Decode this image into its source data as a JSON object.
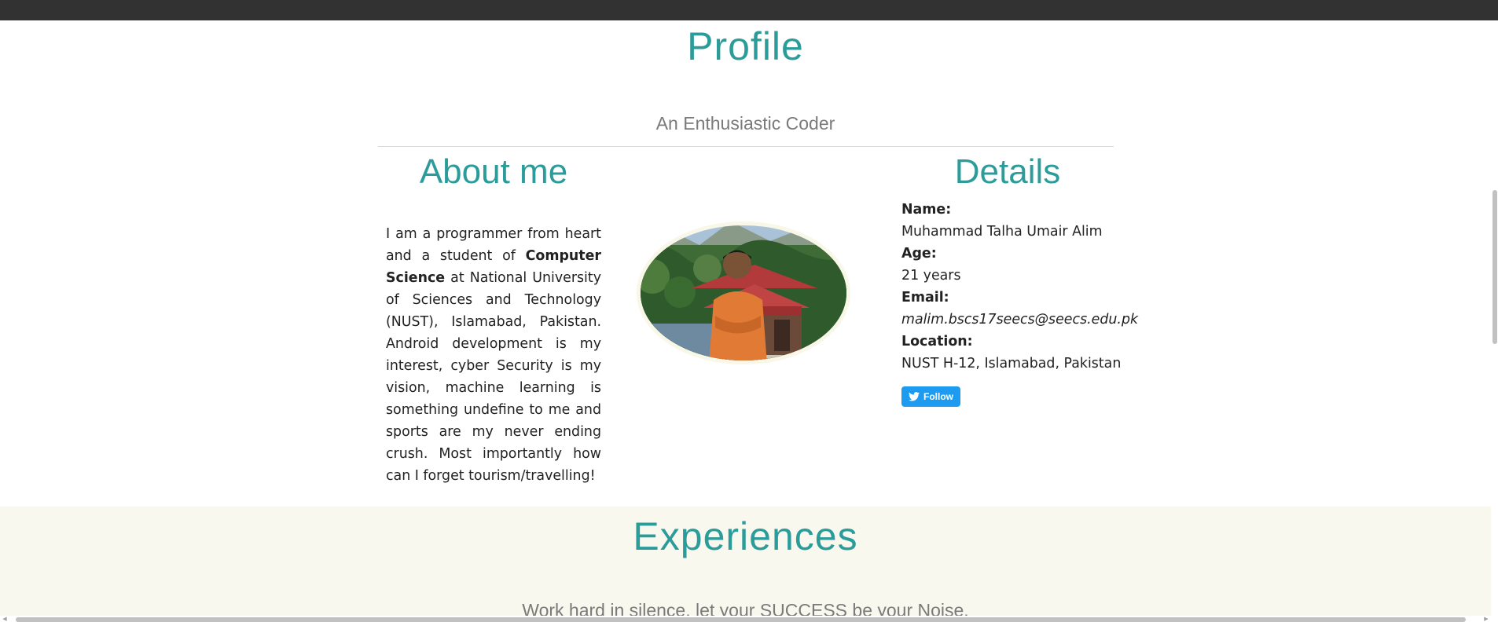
{
  "header": {
    "title": "Profile",
    "tagline": "An Enthusiastic Coder"
  },
  "about": {
    "heading": "About me",
    "text_before": "I am a programmer from heart and a student of ",
    "text_bold": "Computer Science",
    "text_after": " at National University of Sciences and Technology (NUST), Islamabad, Pakistan. Android development is my interest, cyber Security is my vision, machine learning is something undefine to me and sports are my never ending crush. Most importantly how can I forget tourism/travelling!"
  },
  "photo": {
    "subject_icon": "profile-photo"
  },
  "details": {
    "heading": "Details",
    "name_label": "Name:",
    "name_value": "Muhammad Talha Umair Alim",
    "age_label": "Age:",
    "age_value": "21 years",
    "email_label": "Email:",
    "email_value": "malim.bscs17seecs@seecs.edu.pk",
    "location_label": "Location:",
    "location_value": "NUST H-12, Islamabad, Pakistan",
    "follow_label": "Follow"
  },
  "experiences": {
    "title": "Experiences",
    "tagline": "Work hard in silence, let your SUCCESS be your Noise."
  },
  "colors": {
    "accent": "#2c9c9b",
    "twitter": "#1d9bf0",
    "band": "#f8f8ef",
    "topbar": "#323232"
  }
}
